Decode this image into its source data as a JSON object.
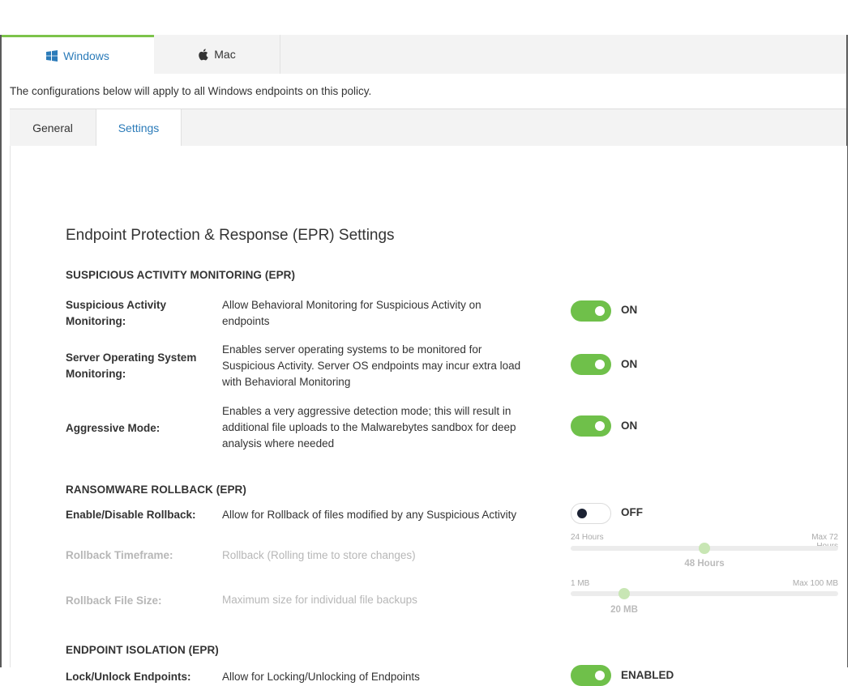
{
  "os_tabs": {
    "windows": {
      "label": "Windows",
      "icon": "windows-icon"
    },
    "mac": {
      "label": "Mac",
      "icon": "apple-icon"
    }
  },
  "notice": "The configurations below will apply to all Windows endpoints on this policy.",
  "sub_tabs": {
    "general": "General",
    "settings": "Settings"
  },
  "page_title": "Endpoint Protection & Response (EPR) Settings",
  "sections": {
    "sam": {
      "title": "SUSPICIOUS ACTIVITY MONITORING (EPR)",
      "rows": [
        {
          "label_l1": "Suspicious Activity",
          "label_l2": "Monitoring:",
          "desc": [
            "Allow Behavioral Monitoring for Suspicious Activity on",
            "endpoints"
          ],
          "state": "ON"
        },
        {
          "label_l1": "Server Operating System",
          "label_l2": "Monitoring:",
          "desc": [
            "Enables server operating systems to be monitored for",
            "Suspicious Activity. Server OS endpoints may incur extra load",
            "with Behavioral Monitoring"
          ],
          "state": "ON"
        },
        {
          "label_l1": "Aggressive Mode:",
          "desc": [
            "Enables a very aggressive detection mode; this will result in",
            "additional file uploads to the Malwarebytes sandbox for deep",
            "analysis where needed"
          ],
          "state": "ON"
        }
      ]
    },
    "rollback": {
      "title": "RANSOMWARE ROLLBACK (EPR)",
      "toggle_row": {
        "label": "Enable/Disable Rollback:",
        "desc": "Allow for Rollback of files modified by any Suspicious Activity",
        "state": "OFF"
      },
      "timeframe": {
        "label": "Rollback Timeframe:",
        "desc": "Rollback (Rolling time to store changes)",
        "min": "24 Hours",
        "max": "Max 72 Hours",
        "value_text": "48 Hours",
        "fraction": 0.5
      },
      "filesize": {
        "label": "Rollback File Size:",
        "desc": "Maximum size for individual file backups",
        "min": "1 MB",
        "max": "Max 100 MB",
        "value_text": "20 MB",
        "fraction": 0.2
      }
    },
    "isolation": {
      "title": "ENDPOINT ISOLATION (EPR)",
      "row": {
        "label": "Lock/Unlock Endpoints:",
        "desc": "Allow for Locking/Unlocking of Endpoints",
        "state": "ENABLED"
      }
    }
  },
  "colors": {
    "accent_green": "#6fc04a",
    "link_blue": "#2b7bb9"
  }
}
